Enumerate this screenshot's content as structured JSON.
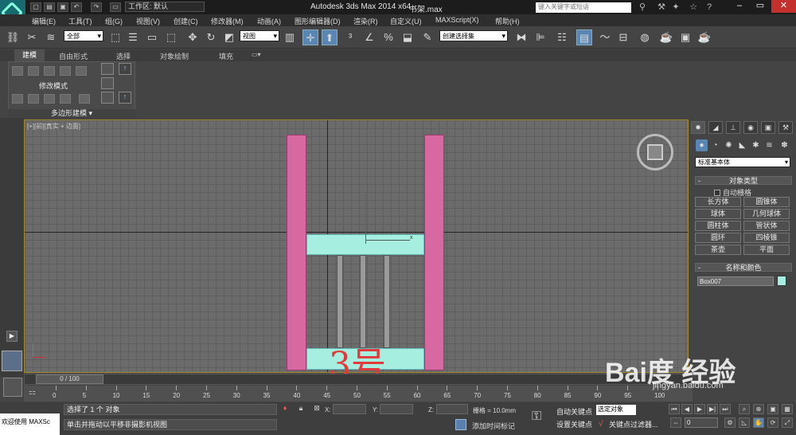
{
  "title": {
    "app": "Autodesk 3ds Max  2014 x64",
    "file": "书架.max",
    "workspace": "工作区: 默认",
    "search_placeholder": "键入关键字或短语"
  },
  "menu": [
    "编辑(E)",
    "工具(T)",
    "组(G)",
    "视图(V)",
    "创建(C)",
    "修改器(M)",
    "动画(A)",
    "图形编辑器(D)",
    "渲染(R)",
    "自定义(U)",
    "MAXScript(X)",
    "帮助(H)"
  ],
  "toolbar": {
    "filter": "全部",
    "view": "视图",
    "selection_set": "创建选择集"
  },
  "ribbon": {
    "tabs": [
      "建模",
      "自由形式",
      "选择",
      "对象绘制",
      "填充"
    ],
    "modify_mode": "修改模式",
    "poly_label": "多边形建模 ▾"
  },
  "viewport": {
    "label": "[+][前][真实 + 边面]"
  },
  "command_panel": {
    "dropdown": "标准基本体",
    "object_type_header": "对象类型",
    "autogrid": "自动栅格",
    "buttons": [
      "长方体",
      "圆锥体",
      "球体",
      "几何球体",
      "圆柱体",
      "管状体",
      "圆环",
      "四棱锥",
      "茶壶",
      "平面"
    ],
    "name_color_header": "名称和颜色",
    "object_name": "Box007",
    "object_color": "#a6eedf"
  },
  "timeline": {
    "frame": "0 / 100",
    "ticks": [
      "0",
      "5",
      "10",
      "15",
      "20",
      "25",
      "30",
      "35",
      "40",
      "45",
      "50",
      "55",
      "60",
      "65",
      "70",
      "75",
      "80",
      "85",
      "90",
      "95",
      "100"
    ]
  },
  "status": {
    "welcome": "欢迎使用 MAXSc",
    "selected": "选择了 1 个 对象",
    "message": "单击并拖动以平移非摄影机视图",
    "x_label": "X:",
    "y_label": "Y:",
    "z_label": "Z:",
    "grid": "栅格 = 10.0mm",
    "add_time_tag": "添加时间标记",
    "auto_key": "自动关键点",
    "set_key": "设置关键点",
    "selected_object": "选定对象",
    "key_filters": "关键点过滤器...",
    "current_frame": "0"
  },
  "annotation": "3号",
  "watermark": {
    "text": "Bai度 经验",
    "url": "jingyan.baidu.com"
  }
}
